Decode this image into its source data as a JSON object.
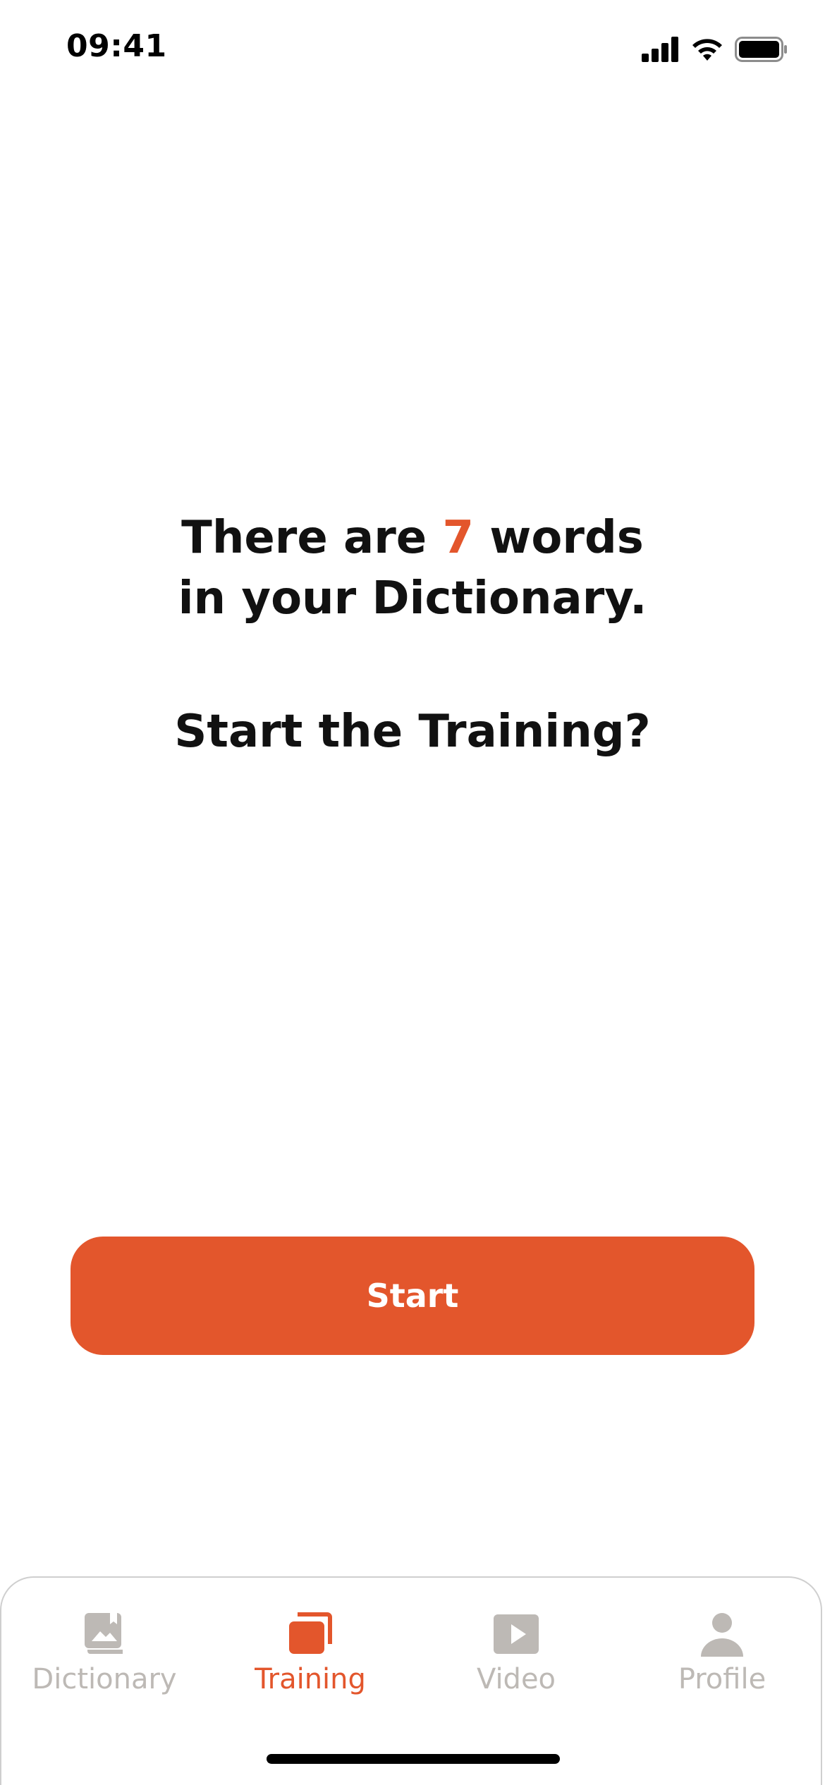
{
  "status_bar": {
    "time": "09:41",
    "icons": [
      "cellular-signal-icon",
      "wifi-icon",
      "battery-icon"
    ]
  },
  "prompt": {
    "line1_prefix": "There are ",
    "word_count": "7",
    "line1_suffix": " words",
    "line2": "in your Dictionary.",
    "question": "Start the Training?"
  },
  "start_button": {
    "label": "Start"
  },
  "tab_bar": {
    "active_tab": "Training",
    "tabs": [
      {
        "label": "Dictionary",
        "icon": "book-icon"
      },
      {
        "label": "Training",
        "icon": "cards-icon"
      },
      {
        "label": "Video",
        "icon": "play-icon"
      },
      {
        "label": "Profile",
        "icon": "person-icon"
      }
    ]
  },
  "colors": {
    "accent": "#e3562c",
    "inactive": "#bdb9b5",
    "text": "#111111",
    "background": "#ffffff"
  }
}
